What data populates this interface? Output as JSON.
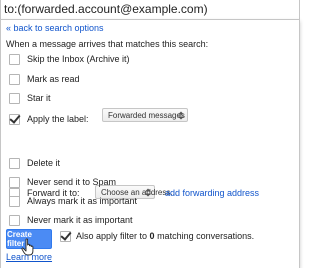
{
  "search": {
    "query": "to:(forwarded.account@example.com)"
  },
  "back_link": "« back to search options",
  "intro": "When a message arrives that matches this search:",
  "options": [
    {
      "label": "Skip the Inbox (Archive it)",
      "checked": false
    },
    {
      "label": "Mark as read",
      "checked": false
    },
    {
      "label": "Star it",
      "checked": false
    },
    {
      "label": "Apply the label:",
      "checked": true
    },
    {
      "label": "Forward it to:",
      "checked": false
    },
    {
      "label": "Delete it",
      "checked": false
    },
    {
      "label": "Never send it to Spam",
      "checked": false
    },
    {
      "label": "Always mark it as important",
      "checked": false
    },
    {
      "label": "Never mark it as important",
      "checked": false
    }
  ],
  "label_select": {
    "value": "Forwarded messages"
  },
  "forward_select": {
    "value": "Choose an address..."
  },
  "add_forwarding": "add forwarding address",
  "create_filter": "Create filter",
  "also_apply": {
    "checked": true,
    "prefix": "Also apply filter to ",
    "count": "0",
    "suffix": " matching conversations."
  },
  "learn_more": "Learn more",
  "colors": {
    "link": "#1155cc",
    "button": "#4b8bf4",
    "border": "#c6c6c6"
  }
}
